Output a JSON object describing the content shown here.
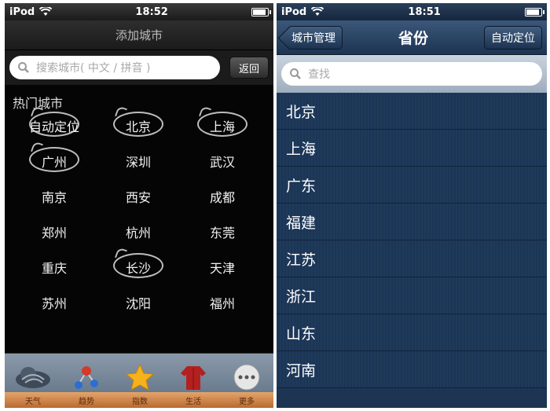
{
  "left": {
    "status": {
      "carrier": "iPod",
      "time": "18:52"
    },
    "nav_title": "添加城市",
    "search": {
      "placeholder": "搜索城市( 中文 / 拼音 )",
      "back_label": "返回"
    },
    "section_title": "热门城市",
    "hot_cities": [
      {
        "name": "自动定位",
        "circled": true
      },
      {
        "name": "北京",
        "circled": true
      },
      {
        "name": "上海",
        "circled": true
      },
      {
        "name": "广州",
        "circled": true
      },
      {
        "name": "深圳",
        "circled": false
      },
      {
        "name": "武汉",
        "circled": false
      },
      {
        "name": "南京",
        "circled": false
      },
      {
        "name": "西安",
        "circled": false
      },
      {
        "name": "成都",
        "circled": false
      },
      {
        "name": "郑州",
        "circled": false
      },
      {
        "name": "杭州",
        "circled": false
      },
      {
        "name": "东莞",
        "circled": false
      },
      {
        "name": "重庆",
        "circled": false
      },
      {
        "name": "长沙",
        "circled": true
      },
      {
        "name": "天津",
        "circled": false
      },
      {
        "name": "苏州",
        "circled": false
      },
      {
        "name": "沈阳",
        "circled": false
      },
      {
        "name": "福州",
        "circled": false
      }
    ],
    "tabs": [
      {
        "label": "天气",
        "icon": "cloud-icon"
      },
      {
        "label": "趋势",
        "icon": "molecule-icon"
      },
      {
        "label": "指数",
        "icon": "star-icon"
      },
      {
        "label": "生活",
        "icon": "shirt-icon"
      },
      {
        "label": "更多",
        "icon": "more-icon"
      }
    ]
  },
  "right": {
    "status": {
      "carrier": "iPod",
      "time": "18:51"
    },
    "back_label": "城市管理",
    "title": "省份",
    "auto_label": "自动定位",
    "search_placeholder": "查找",
    "provinces": [
      "北京",
      "上海",
      "广东",
      "福建",
      "江苏",
      "浙江",
      "山东",
      "河南"
    ]
  },
  "colors": {
    "dark_bg": "#050505",
    "blue_bg": "#1d3552",
    "shelf": "#d08444"
  }
}
